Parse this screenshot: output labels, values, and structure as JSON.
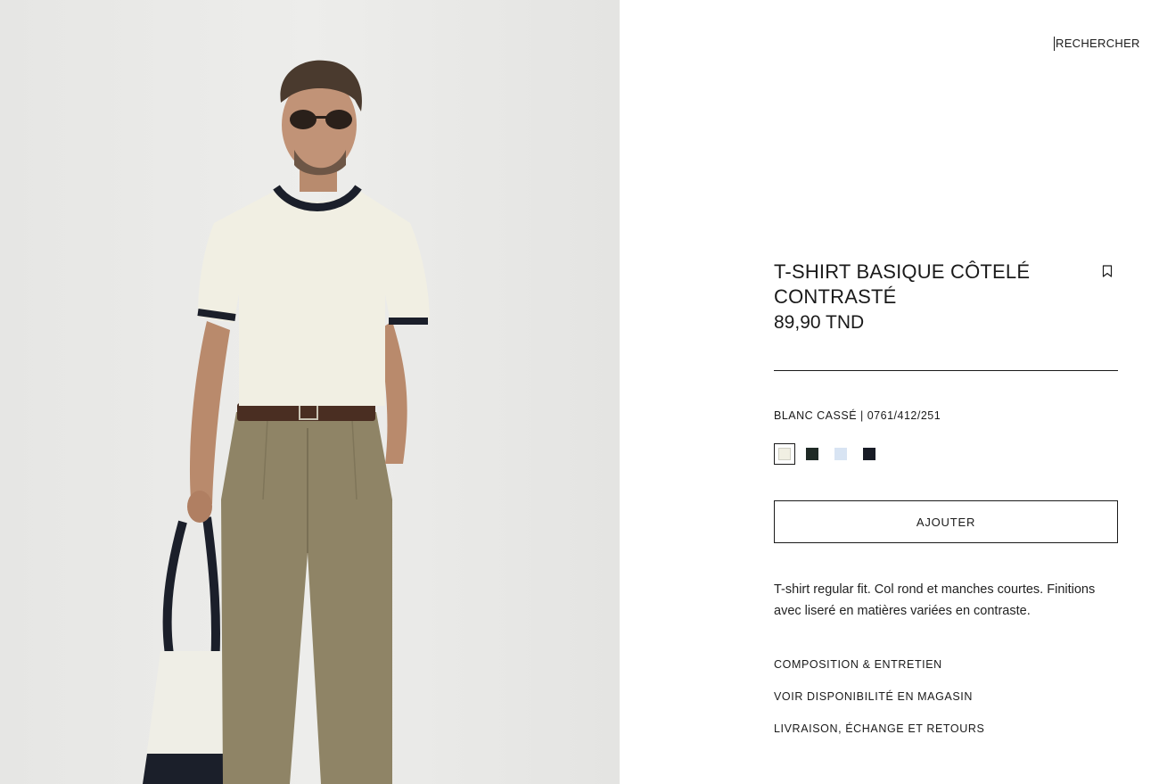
{
  "header": {
    "search_label": "RECHERCHER"
  },
  "product": {
    "title": "T-SHIRT BASIQUE CÔTELÉ CONTRASTÉ",
    "price": "89,90 TND",
    "color_and_ref": "BLANC CASSÉ | 0761/412/251",
    "bookmark_icon": "bookmark-icon",
    "swatches": [
      {
        "name": "blanc-casse",
        "color": "#f1efe3",
        "selected": true
      },
      {
        "name": "dark-green",
        "color": "#1f2a26",
        "selected": false
      },
      {
        "name": "light-blue",
        "color": "#d8e4f3",
        "selected": false
      },
      {
        "name": "navy",
        "color": "#181c26",
        "selected": false
      }
    ],
    "add_button_label": "AJOUTER",
    "description": "T-shirt regular fit. Col rond et manches courtes. Finitions avec liseré en matières variées en contraste."
  },
  "info_links": [
    "COMPOSITION & ENTRETIEN",
    "VOIR DISPONIBILITÉ EN MAGASIN",
    "LIVRAISON, ÉCHANGE ET RETOURS"
  ],
  "colors": {
    "text": "#1a1a1a",
    "background": "#ffffff",
    "photo_background": "#e9e9e7"
  }
}
